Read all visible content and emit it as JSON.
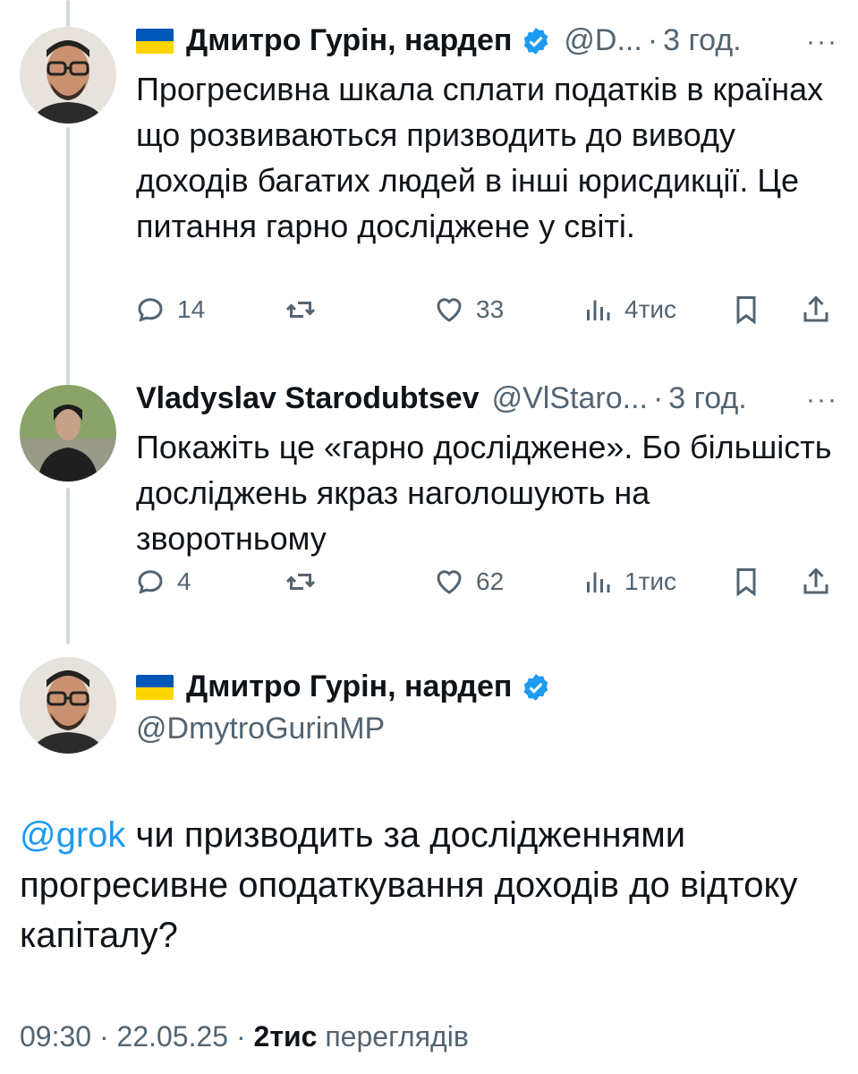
{
  "tweet1": {
    "name": "Дмитро Гурін, нардеп",
    "handle": "@D...",
    "time": "3 год.",
    "text": "Прогресивна шкала сплати податків в країнах що розвиваються призводить до виводу доходів багатих людей в інші юрисдикції. Це питання гарно досліджене у світі.",
    "replies": "14",
    "likes": "33",
    "views": "4тис",
    "more": "···"
  },
  "tweet2": {
    "name": "Vladyslav Starodubtsev",
    "handle": "@VlStaro...",
    "time": "3 год.",
    "text": "Покажіть це «гарно досліджене». Бо більшість досліджень якраз наголошують на зворотньому",
    "replies": "4",
    "likes": "62",
    "views": "1тис",
    "more": "···"
  },
  "main_tweet": {
    "name": "Дмитро Гурін, нардеп",
    "handle": "@DmytroGurinMP",
    "mention": "@grok",
    "text": " чи призводить за дослідженнями прогресивне оподаткування доходів до відтоку капіталу?",
    "time": "09:30",
    "date": "22.05.25",
    "views_count": "2тис",
    "views_label": "переглядів"
  },
  "colors": {
    "accent": "#1d9bf0",
    "secondary_text": "#536471",
    "thread_line": "#cfd9de"
  },
  "icons": [
    "reply-icon",
    "retweet-icon",
    "like-icon",
    "views-icon",
    "bookmark-icon",
    "share-icon",
    "verified-badge-icon",
    "ukraine-flag-icon",
    "more-icon"
  ]
}
